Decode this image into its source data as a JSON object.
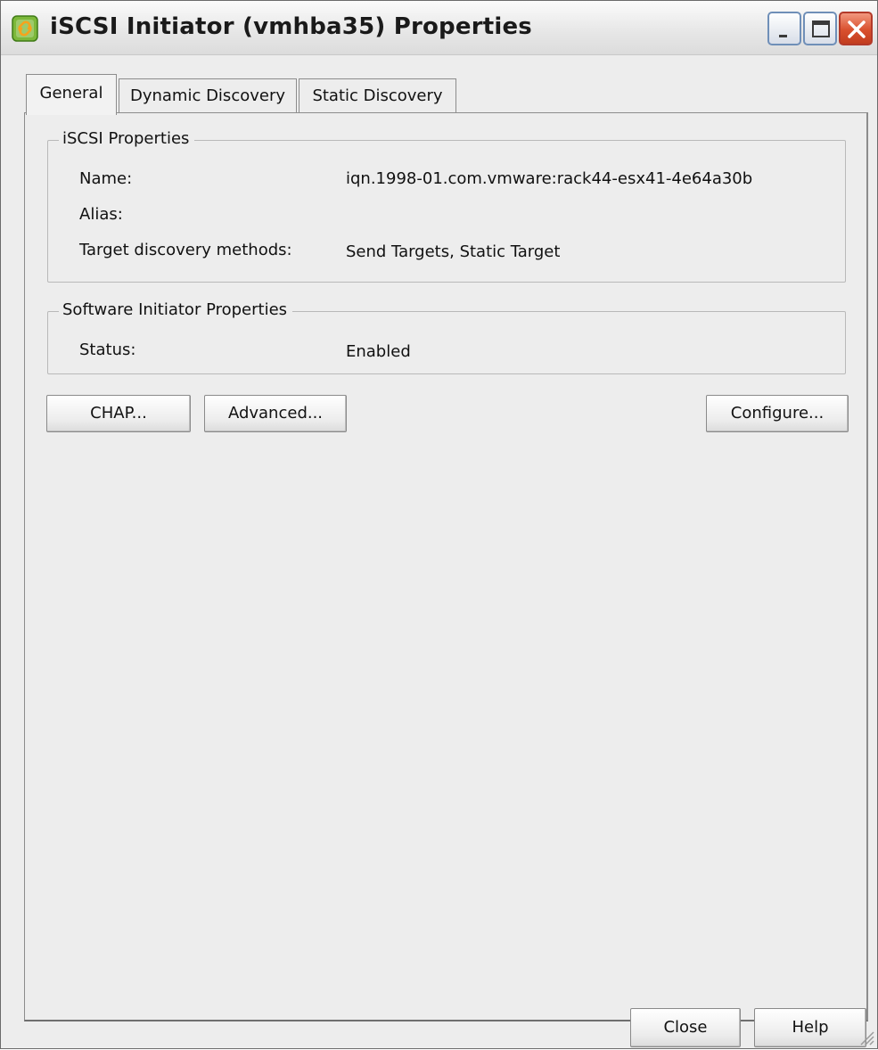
{
  "window": {
    "title": "iSCSI Initiator (vmhba35) Properties",
    "icon": "vmware-link-icon",
    "controls": [
      "minimize",
      "maximize",
      "close"
    ]
  },
  "tabs": [
    {
      "label": "General",
      "selected": true
    },
    {
      "label": "Dynamic Discovery",
      "selected": false
    },
    {
      "label": "Static Discovery",
      "selected": false
    }
  ],
  "iscsi_properties": {
    "legend": "iSCSI Properties",
    "name_label": "Name:",
    "name_value": "iqn.1998-01.com.vmware:rack44-esx41-4e64a30b",
    "alias_label": "Alias:",
    "alias_value": "",
    "discovery_label": "Target discovery methods:",
    "discovery_value": "Send Targets, Static Target"
  },
  "software_initiator": {
    "legend": "Software Initiator Properties",
    "status_label": "Status:",
    "status_value": "Enabled"
  },
  "buttons": {
    "chap": "CHAP...",
    "advanced": "Advanced...",
    "configure": "Configure...",
    "close": "Close",
    "help": "Help"
  },
  "colors": {
    "window_bg": "#ededed",
    "close_button": "#d9502e",
    "icon_green": "#f5a623"
  }
}
